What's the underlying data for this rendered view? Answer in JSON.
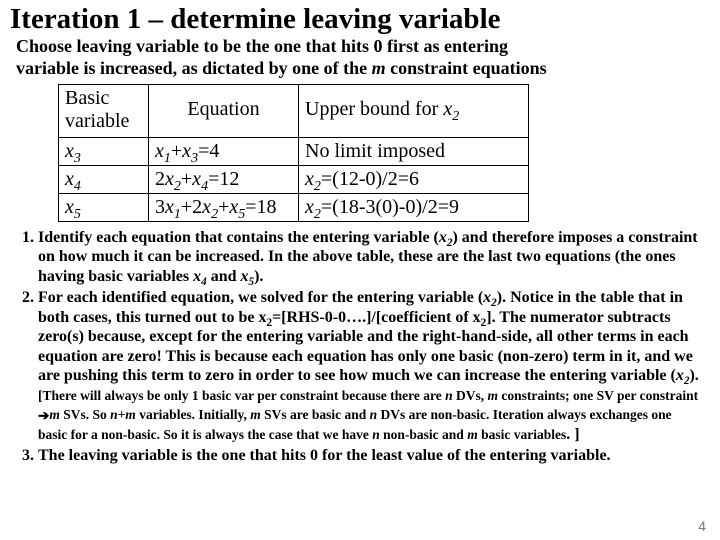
{
  "title": "Iteration 1 – determine leaving variable",
  "subtitle_a": "Choose leaving variable to be the one that hits 0 first as entering ",
  "subtitle_b": "variable is increased, as dictated by one of the ",
  "subtitle_m": "m",
  "subtitle_c": " constraint equations",
  "table": {
    "h0_a": "Basic",
    "h0_b": "variable",
    "h1": "Equation",
    "h2_a": "Upper bound for ",
    "h2_var": "x",
    "h2_sub": "2",
    "r1c0_var": "x",
    "r1c0_sub": "3",
    "r1c1_a": "x",
    "r1c1_asub": "1",
    "r1c1_plus": "+",
    "r1c1_b": "x",
    "r1c1_bsub": "3",
    "r1c1_eq": "=4",
    "r1c2": "No limit imposed",
    "r2c0_var": "x",
    "r2c0_sub": "4",
    "r2c1_a": "2",
    "r2c1_b": "x",
    "r2c1_bsub": "2",
    "r2c1_plus": "+",
    "r2c1_c": "x",
    "r2c1_csub": "4",
    "r2c1_eq": "=12",
    "r2c2_a": "x",
    "r2c2_asub": "2",
    "r2c2_rest": "=(12-0)/2=6",
    "r3c0_var": "x",
    "r3c0_sub": "5",
    "r3c1_a": "3",
    "r3c1_b": "x",
    "r3c1_bsub": "1",
    "r3c1_plus1": "+2",
    "r3c1_c": "x",
    "r3c1_csub": "2",
    "r3c1_plus2": "+",
    "r3c1_d": "x",
    "r3c1_dsub": "5",
    "r3c1_eq": "=18",
    "r3c2_a": "x",
    "r3c2_asub": "2",
    "r3c2_rest": "=(18-3(0)-0)/2=9"
  },
  "li1_a": "Identify each equation that contains the entering variable (",
  "li1_var": "x",
  "li1_sub": "2",
  "li1_b": ") and therefore imposes a constraint on how much it can be increased. In the above table, these are the last two equations (the ones having basic variables ",
  "li1_c_var1": "x",
  "li1_c_sub1": "4",
  "li1_c_mid": " and ",
  "li1_c_var2": "x",
  "li1_c_sub2": "5",
  "li1_d": ").",
  "li2_a": "For each identified equation, we solved for the entering variable (",
  "li2_var": "x",
  "li2_sub": "2",
  "li2_b": "). Notice in the table that in both cases, this turned out to be x",
  "li2_b_sub": "2",
  "li2_c": "=[RHS-0-0….]/[coefficient of x",
  "li2_c_sub": "2",
  "li2_d": "]. The numerator subtracts zero(s) because, except for the entering variable and the right-hand-side, all other terms in each equation are zero! This is because each equation has only one basic (non-zero) term in it, and we are pushing this term to zero in order to see how much we can increase the entering variable (",
  "li2_e_var": "x",
  "li2_e_sub": "2",
  "li2_f": "). ",
  "note_a": "[",
  "note_b": "There will always be only 1 basic var per constraint because there are ",
  "note_n1": "n",
  "note_c": " DVs, ",
  "note_m1": "m",
  "note_d": " constraints; one SV per constraint",
  "note_arrow": "➔",
  "note_m2": "m",
  "note_e": " SVs. So ",
  "note_nm": "n+m",
  "note_f": " variables. Initially, ",
  "note_m3": "m",
  "note_g": " SVs are basic and ",
  "note_n2": "n",
  "note_h": " DVs are non-basic. Iteration always exchanges one basic for a non-basic. So it is always the case that we have ",
  "note_n3": "n",
  "note_i": " non-basic and ",
  "note_m4": "m",
  "note_j": " basic variables",
  "note_k": ". ]",
  "li3": "The leaving variable is the one that hits 0 for the least value of the entering variable.",
  "page": "4"
}
